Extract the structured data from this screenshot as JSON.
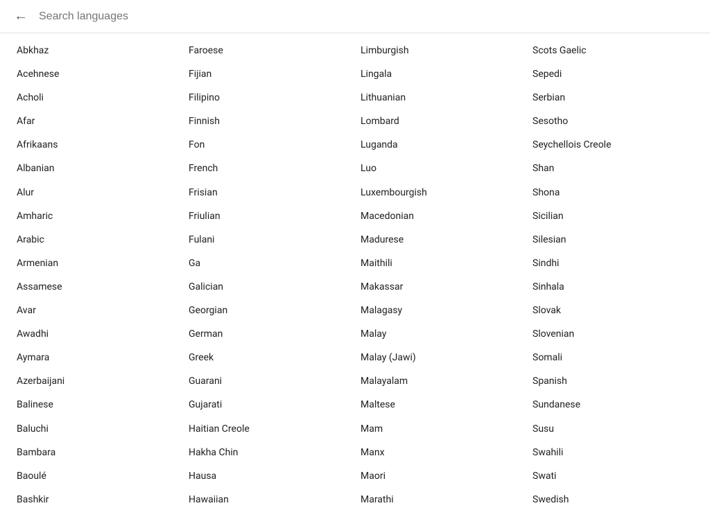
{
  "header": {
    "back_label": "←",
    "search_placeholder": "Search languages"
  },
  "columns": [
    [
      "Abkhaz",
      "Acehnese",
      "Acholi",
      "Afar",
      "Afrikaans",
      "Albanian",
      "Alur",
      "Amharic",
      "Arabic",
      "Armenian",
      "Assamese",
      "Avar",
      "Awadhi",
      "Aymara",
      "Azerbaijani",
      "Balinese",
      "Baluchi",
      "Bambara",
      "Baoulé",
      "Bashkir"
    ],
    [
      "Faroese",
      "Fijian",
      "Filipino",
      "Finnish",
      "Fon",
      "French",
      "Frisian",
      "Friulian",
      "Fulani",
      "Ga",
      "Galician",
      "Georgian",
      "German",
      "Greek",
      "Guarani",
      "Gujarati",
      "Haitian Creole",
      "Hakha Chin",
      "Hausa",
      "Hawaiian"
    ],
    [
      "Limburgish",
      "Lingala",
      "Lithuanian",
      "Lombard",
      "Luganda",
      "Luo",
      "Luxembourgish",
      "Macedonian",
      "Madurese",
      "Maithili",
      "Makassar",
      "Malagasy",
      "Malay",
      "Malay (Jawi)",
      "Malayalam",
      "Maltese",
      "Mam",
      "Manx",
      "Maori",
      "Marathi"
    ],
    [
      "Scots Gaelic",
      "Sepedi",
      "Serbian",
      "Sesotho",
      "Seychellois Creole",
      "Shan",
      "Shona",
      "Sicilian",
      "Silesian",
      "Sindhi",
      "Sinhala",
      "Slovak",
      "Slovenian",
      "Somali",
      "Spanish",
      "Sundanese",
      "Susu",
      "Swahili",
      "Swati",
      "Swedish"
    ]
  ]
}
